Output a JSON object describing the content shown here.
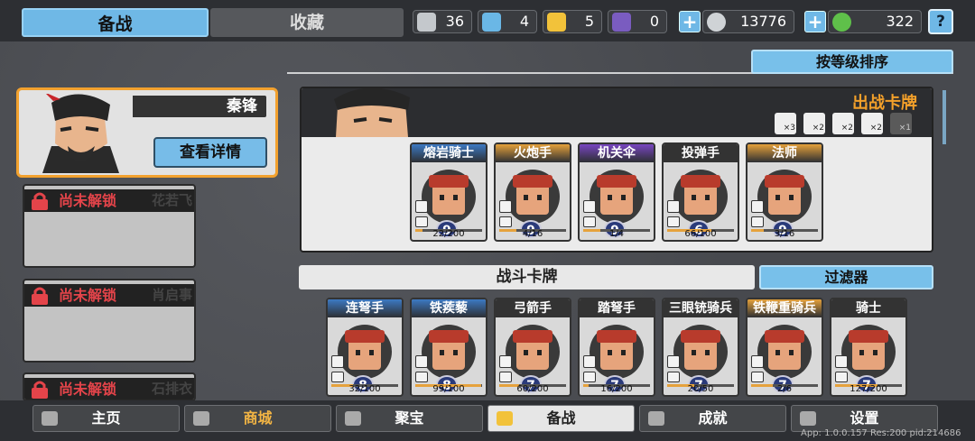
{
  "tabs": {
    "prepare": "备战",
    "collection": "收藏"
  },
  "resources": [
    {
      "icon": "silver-shield-icon",
      "value": "36",
      "color": "#c4c8cc"
    },
    {
      "icon": "blue-shield-icon",
      "value": "4",
      "color": "#6ab7e6"
    },
    {
      "icon": "gold-shield-icon",
      "value": "5",
      "color": "#f2c23a"
    },
    {
      "icon": "purple-mask-icon",
      "value": "0",
      "color": "#7a5cc0"
    },
    {
      "icon": "silver-coin-icon",
      "value": "13776",
      "color": "#cfd3d6"
    },
    {
      "icon": "green-coin-icon",
      "value": "322",
      "color": "#5fc04a"
    }
  ],
  "help_label": "?",
  "sort_label": "按等级排序",
  "leader": {
    "name": "秦锋",
    "detail_label": "查看详情"
  },
  "locked": [
    {
      "status": "尚未解锁",
      "name": "花若飞"
    },
    {
      "status": "尚未解锁",
      "name": "肖启事"
    },
    {
      "status": "尚未解锁",
      "name": "石排衣"
    }
  ],
  "deck": {
    "title": "出战卡牌",
    "slots": [
      {
        "label": "×3",
        "active": true
      },
      {
        "label": "×2",
        "active": true
      },
      {
        "label": "×2",
        "active": true
      },
      {
        "label": "×2",
        "active": true
      },
      {
        "label": "×1",
        "active": false
      }
    ],
    "cards": [
      {
        "name": "熔岩骑士",
        "level": "9",
        "count": "22/200",
        "rarity": "blue",
        "progress": 0.11
      },
      {
        "name": "火炮手",
        "level": "9",
        "count": "4/16",
        "rarity": "gold",
        "progress": 0.25
      },
      {
        "name": "机关伞",
        "level": "9",
        "count": "1/4",
        "rarity": "purple",
        "progress": 0.25
      },
      {
        "name": "投弹手",
        "level": "6",
        "count": "66/100",
        "rarity": "gray",
        "progress": 0.66
      },
      {
        "name": "法师",
        "level": "9",
        "count": "3/16",
        "rarity": "gold",
        "progress": 0.19
      }
    ]
  },
  "battle": {
    "title": "战斗卡牌",
    "filter_label": "过滤器",
    "cards": [
      {
        "name": "连弩手",
        "level": "8",
        "count": "32/100",
        "rarity": "blue",
        "progress": 0.32
      },
      {
        "name": "铁蒺藜",
        "level": "8",
        "count": "99/100",
        "rarity": "blue",
        "progress": 0.99
      },
      {
        "name": "弓箭手",
        "level": "7",
        "count": "60/200",
        "rarity": "gray",
        "progress": 0.3
      },
      {
        "name": "踏弩手",
        "level": "7",
        "count": "16/200",
        "rarity": "gray",
        "progress": 0.08
      },
      {
        "name": "三眼铳骑兵",
        "level": "7",
        "count": "20/50",
        "rarity": "gray",
        "progress": 0.4
      },
      {
        "name": "铁鞭重骑兵",
        "level": "7",
        "count": "2/6",
        "rarity": "gold",
        "progress": 0.33
      },
      {
        "name": "骑士",
        "level": "7",
        "count": "127/200",
        "rarity": "gray",
        "progress": 0.64
      }
    ]
  },
  "nav": [
    {
      "label": "主页",
      "icon": "home-icon"
    },
    {
      "label": "商城",
      "icon": "shop-icon"
    },
    {
      "label": "聚宝",
      "icon": "treasure-icon"
    },
    {
      "label": "备战",
      "icon": "cards-icon"
    },
    {
      "label": "成就",
      "icon": "achievement-icon"
    },
    {
      "label": "设置",
      "icon": "gear-icon"
    }
  ],
  "version": "App: 1.0.0.157 Res:200 pid:214686"
}
